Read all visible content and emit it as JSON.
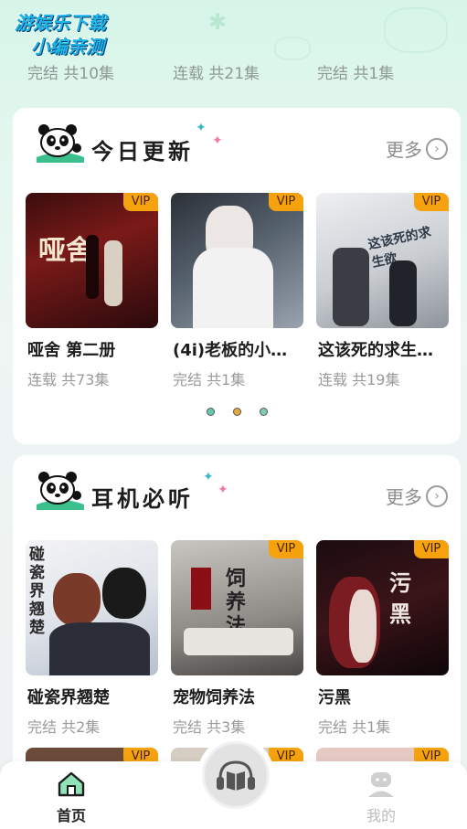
{
  "watermark": {
    "line1": "游娱乐下载",
    "line2": "小编亲测"
  },
  "top_row": {
    "metas": [
      "完结 共10集",
      "连载 共21集",
      "完结 共1集"
    ]
  },
  "today_update": {
    "title": "今日更新",
    "more_label": "更多",
    "items": [
      {
        "title": "哑舍 第二册",
        "meta": "连载 共73集",
        "vip": "VIP",
        "cover_text": "哑舍"
      },
      {
        "title": "(4i)老板的小…",
        "meta": "完结 共1集",
        "vip": "VIP",
        "cover_text": ""
      },
      {
        "title": "这该死的求生…",
        "meta": "连载 共19集",
        "vip": "VIP",
        "cover_text": "这该死的求生欲"
      }
    ],
    "page_dots": 3
  },
  "headphone_must": {
    "title": "耳机必听",
    "more_label": "更多",
    "items": [
      {
        "title": "碰瓷界翘楚",
        "meta": "完结 共2集",
        "vip": "",
        "cover_text": "碰瓷界翘楚"
      },
      {
        "title": "宠物饲养法",
        "meta": "完结 共3集",
        "vip": "VIP",
        "cover_text": "饲养法"
      },
      {
        "title": "污黑",
        "meta": "完结 共1集",
        "vip": "VIP",
        "cover_text": "污黑"
      }
    ],
    "next_row_vips": [
      "VIP",
      "VIP",
      "VIP"
    ]
  },
  "nav": {
    "home_label": "首页",
    "mine_label": "我的"
  },
  "colors": {
    "vip_badge": "#f5a20e",
    "accent_green": "#3bbf8d"
  }
}
